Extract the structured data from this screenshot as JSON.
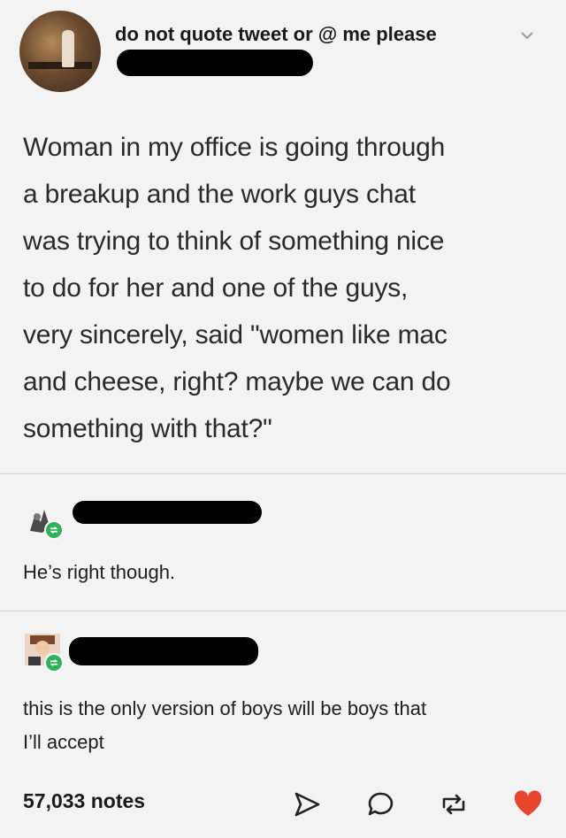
{
  "header": {
    "username": "do not quote tweet or @ me please"
  },
  "post": {
    "lines": [
      "Woman in my office is going through",
      "a breakup and the work guys chat",
      "was trying to think of something nice",
      "to do for her and one of the guys,",
      "very sincerely, said \"women like mac",
      "and cheese, right? maybe we can do",
      "something with that?\""
    ]
  },
  "replies": [
    {
      "text": "He’s right though."
    },
    {
      "lines": [
        "this is the only version of boys will be boys that",
        "I’ll accept"
      ]
    }
  ],
  "footer": {
    "notes": "57,033 notes",
    "icons": [
      "share-icon",
      "reply-icon",
      "reblog-icon",
      "heart-icon"
    ],
    "like_color": "#e8452c"
  },
  "colors": {
    "background": "#f3f3f3",
    "reblog_badge": "#2fb25b"
  }
}
